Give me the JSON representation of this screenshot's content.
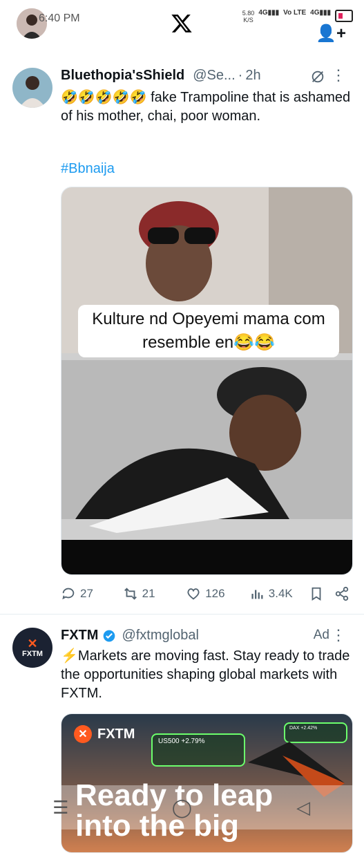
{
  "status_bar": {
    "time": "6:40 PM",
    "speed": "5.80",
    "speed_unit": "K/S",
    "net1": "4G",
    "volte": "Vo LTE",
    "net2": "4G"
  },
  "tweet1": {
    "name": "Bluethopia'sShield",
    "handle": "@Se...",
    "time": "2h",
    "text": "🤣🤣🤣🤣🤣 fake Trampoline that is ashamed of his mother, chai, poor woman.",
    "hashtag": "#Bbnaija",
    "media_caption": "Kulture nd Opeyemi mama com resemble en😂😂",
    "replies": "27",
    "reposts": "21",
    "likes": "126",
    "views": "3.4K"
  },
  "tweet2": {
    "name": "FXTM",
    "handle": "@fxtmglobal",
    "ad_label": "Ad",
    "text": "⚡Markets are moving fast. Stay ready to trade the opportunities shaping global markets with FXTM.",
    "avatar_label": "FXTM",
    "banner_brand": "FXTM",
    "banner_tag1": "US500 +2.79%",
    "banner_tag2": "DAX +2.42%",
    "banner_headline": "Ready to leap into the big"
  },
  "colors": {
    "link": "#1d9bf0",
    "text": "#0f1419",
    "muted": "#536471"
  }
}
